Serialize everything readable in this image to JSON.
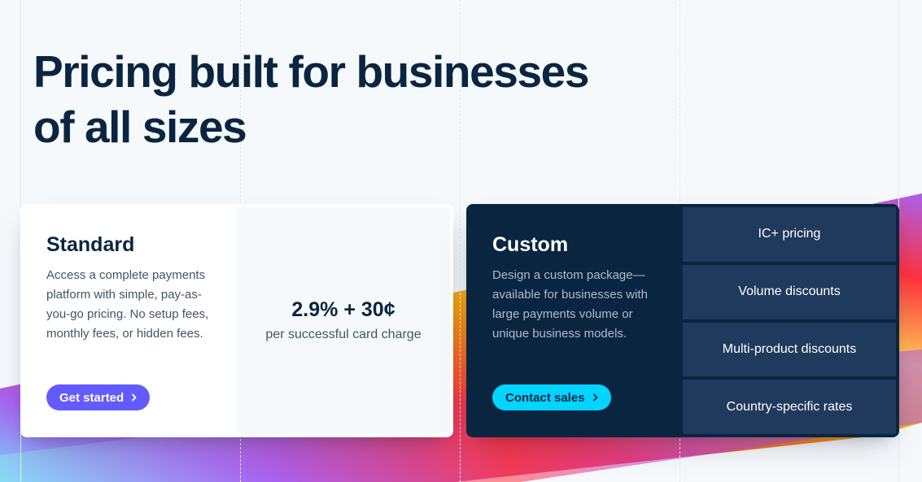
{
  "hero": {
    "title_line1": "Pricing built for businesses",
    "title_line2": "of all sizes"
  },
  "standard": {
    "title": "Standard",
    "description": "Access a complete payments platform with simple, pay-as-you-go pricing. No setup fees, monthly fees, or hidden fees.",
    "cta": "Get started",
    "price": "2.9% + 30¢",
    "price_note": "per successful card charge"
  },
  "custom": {
    "title": "Custom",
    "description": "Design a custom package—available for businesses with large payments volume or unique business models.",
    "cta": "Contact sales",
    "features": [
      "IC+ pricing",
      "Volume discounts",
      "Multi-product discounts",
      "Country-specific rates"
    ]
  },
  "colors": {
    "navy": "#0a2540",
    "purple": "#635bff",
    "cyan": "#00d4ff",
    "feature_bg": "#1f3a5c",
    "background": "#f6f9fc"
  },
  "icons": {
    "cta_chevron": "chevron-right-icon"
  }
}
